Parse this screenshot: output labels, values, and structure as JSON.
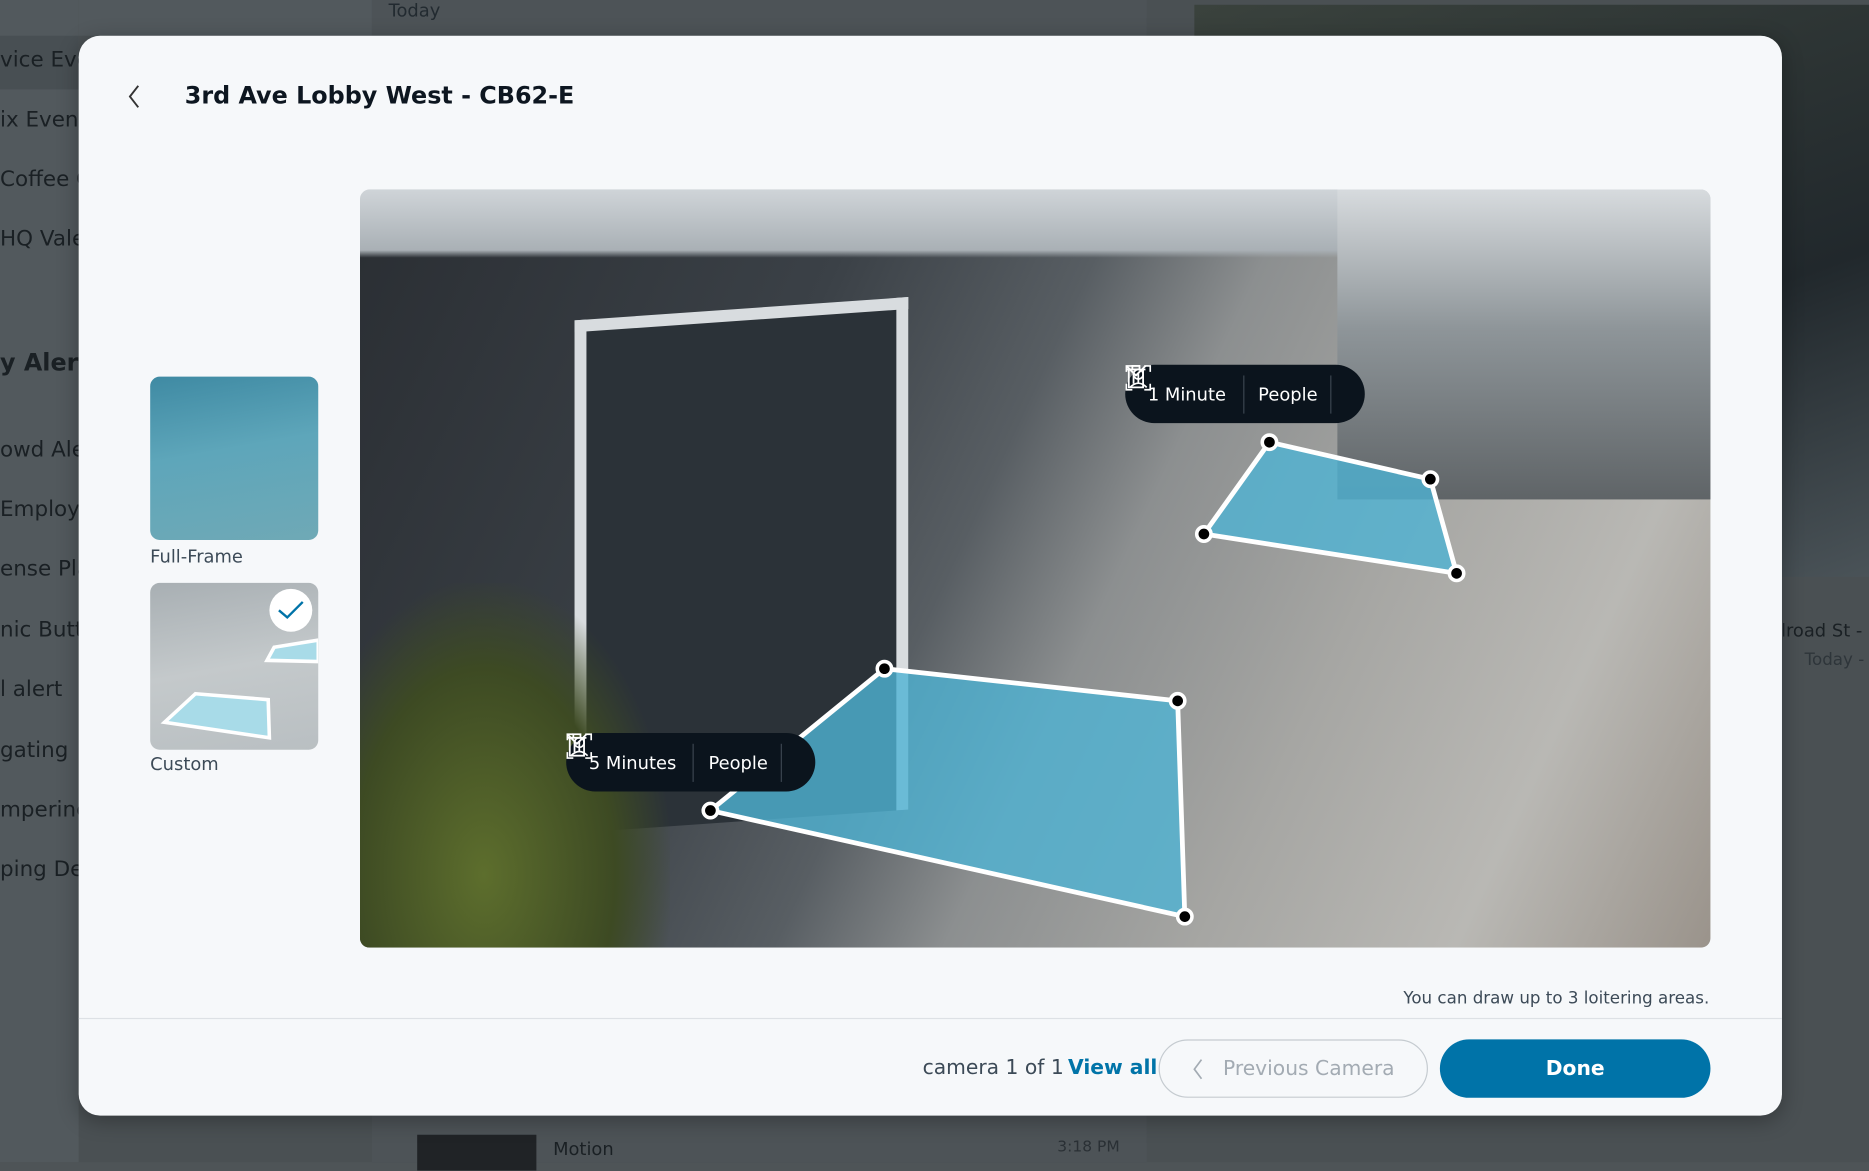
{
  "background": {
    "sidebar_items": [
      "vice Even",
      "ix Event",
      "Coffee C",
      "HQ Vale",
      "y Alerts",
      "owd Aler",
      "Employe",
      "ense Pla",
      "nic Butto",
      "l alert",
      "gating",
      "mpering",
      "ping Det"
    ],
    "list_header": "Today",
    "event_label": "Motion",
    "event_time": "3:18 PM",
    "right_camera_name": "ilroad St - (",
    "right_camera_time": "Today -"
  },
  "modal": {
    "title": "3rd Ave Lobby West - CB62-E",
    "back_icon": "chevron-left-icon",
    "modes": [
      {
        "label": "Full-Frame",
        "selected": false
      },
      {
        "label": "Custom",
        "selected": true
      }
    ],
    "zones": [
      {
        "duration": "1 Minute",
        "object": "People",
        "object_icon": "person-detect-icon",
        "delete_icon": "trash-icon"
      },
      {
        "duration": "5 Minutes",
        "object": "People",
        "object_icon": "person-detect-icon",
        "delete_icon": "trash-icon"
      }
    ],
    "zone_color": "#4fb3d3",
    "hint": "You can draw up to 3 loitering areas.",
    "footer": {
      "counter": "camera 1 of 1",
      "view_all": "View all",
      "previous": "Previous Camera",
      "done": "Done"
    },
    "accent": "#0073a8"
  }
}
